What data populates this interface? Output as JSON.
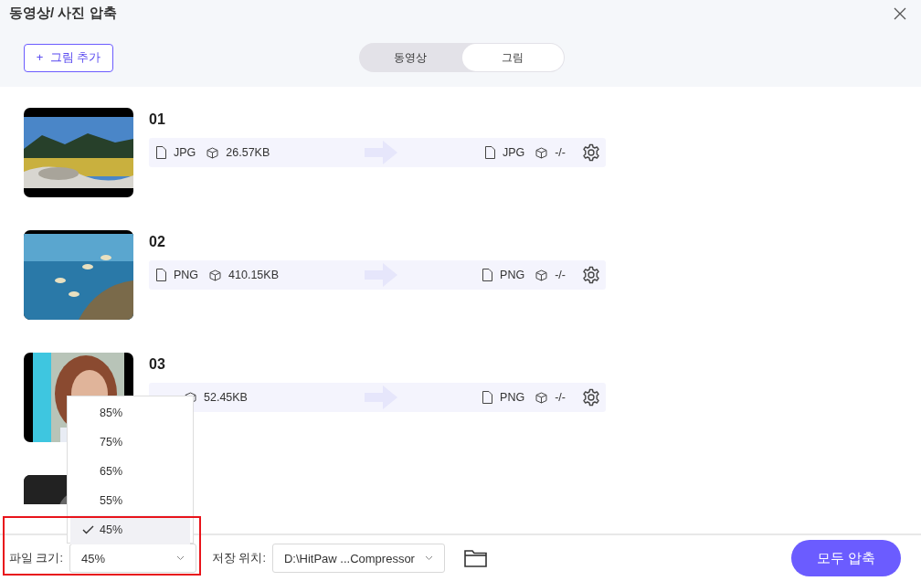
{
  "window": {
    "title": "동영상/ 사진 압축"
  },
  "add_button": {
    "label": "그림 추가",
    "icon": "+"
  },
  "tabs": [
    {
      "label": "동영상",
      "selected": false
    },
    {
      "label": "그림",
      "selected": true
    }
  ],
  "files": [
    {
      "name": "01",
      "kind": "picture",
      "from": {
        "format": "JPG",
        "size": "26.57KB"
      },
      "to": {
        "format": "JPG",
        "size": "-/-"
      }
    },
    {
      "name": "02",
      "kind": "picture",
      "from": {
        "format": "PNG",
        "size": "410.15KB"
      },
      "to": {
        "format": "PNG",
        "size": "-/-"
      }
    },
    {
      "name": "03",
      "kind": "picture",
      "from": {
        "size": "52.45KB"
      },
      "to": {
        "format": "PNG",
        "size": "-/-"
      }
    },
    {
      "kind": "picture"
    }
  ],
  "footer": {
    "size_label": "파일 크기:",
    "size_value": "45%",
    "location_label": "저장 위치:",
    "location_value": "D:\\HitPaw ...Compressor",
    "compress_button": "모두 압축"
  },
  "size_menu": [
    {
      "label": "85%",
      "selected": false
    },
    {
      "label": "75%",
      "selected": false
    },
    {
      "label": "65%",
      "selected": false
    },
    {
      "label": "55%",
      "selected": false
    },
    {
      "label": "45%",
      "selected": true
    }
  ]
}
